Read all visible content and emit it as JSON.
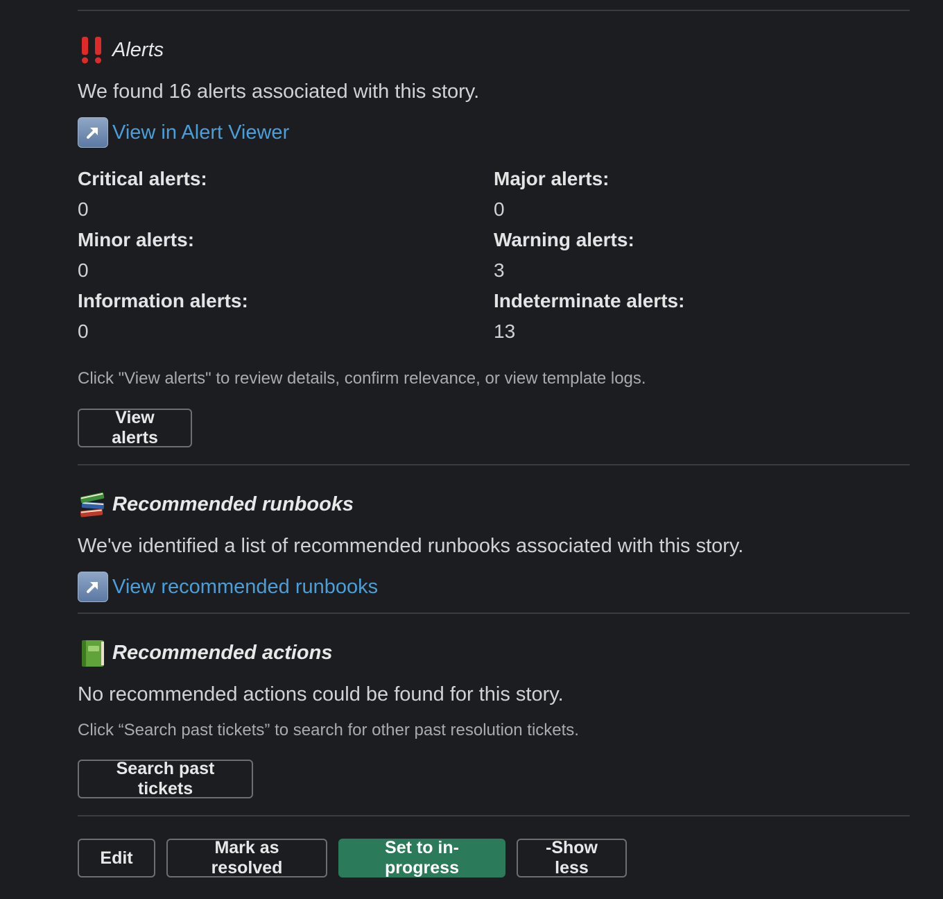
{
  "alerts": {
    "title": "Alerts",
    "icon": "double-exclamation-icon",
    "summary": "We found 16 alerts associated with this story.",
    "link_label": "View in Alert Viewer",
    "counts": [
      {
        "label": "Critical alerts:",
        "value": "0"
      },
      {
        "label": "Major alerts:",
        "value": "0"
      },
      {
        "label": "Minor alerts:",
        "value": "0"
      },
      {
        "label": "Warning alerts:",
        "value": "3"
      },
      {
        "label": "Information alerts:",
        "value": "0"
      },
      {
        "label": "Indeterminate alerts:",
        "value": "13"
      }
    ],
    "hint": "Click \"View alerts\" to review details, confirm relevance, or view template logs.",
    "button_label": "View alerts"
  },
  "runbooks": {
    "title": "Recommended runbooks",
    "icon": "books-icon",
    "summary": "We've identified a list of recommended runbooks associated with this story.",
    "link_label": "View recommended runbooks"
  },
  "recommended_actions": {
    "title": "Recommended actions",
    "icon": "green-book-icon",
    "summary": "No recommended actions could be found for this story.",
    "hint": "Click “Search past tickets” to search for other past resolution tickets.",
    "button_label": "Search past tickets"
  },
  "footer": {
    "edit_label": "Edit",
    "resolve_label": "Mark as resolved",
    "in_progress_label": "Set to in-progress",
    "show_less_label": "-Show less"
  },
  "colors": {
    "background": "#1b1d21",
    "link": "#4a9fd8",
    "primary_button": "#2b7a5a",
    "divider": "#3a3c41"
  }
}
